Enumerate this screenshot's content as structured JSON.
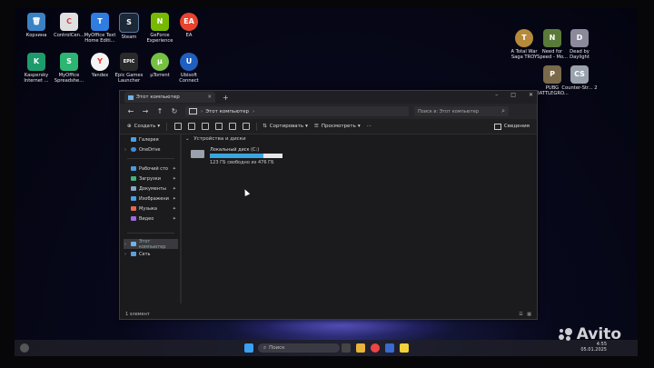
{
  "desktop_icons": [
    {
      "label": "Корзина",
      "icon": "recycle-bin-icon",
      "color": "#3b82c4"
    },
    {
      "label": "ControlCen...",
      "icon": "control-center-icon",
      "color": "#e0e0e0"
    },
    {
      "label": "MyOffice Text Home Editi...",
      "icon": "myoffice-text-icon",
      "color": "#2f7de1"
    },
    {
      "label": "Steam",
      "icon": "steam-icon",
      "color": "#1b2838"
    },
    {
      "label": "GeForce Experience",
      "icon": "geforce-icon",
      "color": "#76b900"
    },
    {
      "label": "EA",
      "icon": "ea-icon",
      "color": "#e8432e"
    },
    {
      "label": "Kaspersky Internet ...",
      "icon": "kaspersky-icon",
      "color": "#1d9b6c"
    },
    {
      "label": "MyOffice Spreadshe...",
      "icon": "myoffice-sheet-icon",
      "color": "#2bb673"
    },
    {
      "label": "Yandex",
      "icon": "yandex-icon",
      "color": "#f4f4f4"
    },
    {
      "label": "Epic Games Launcher",
      "icon": "epic-games-icon",
      "color": "#2a2a2a"
    },
    {
      "label": "µTorrent",
      "icon": "utorrent-icon",
      "color": "#76c043"
    },
    {
      "label": "Ubisoft Connect",
      "icon": "ubisoft-icon",
      "color": "#1f5fbf"
    },
    {
      "label": "A Total War Saga TROY",
      "icon": "troy-icon",
      "color": "#b58a3a"
    },
    {
      "label": "Need for Speed - Mo...",
      "icon": "nfs-icon",
      "color": "#5a7a3a"
    },
    {
      "label": "Dead by Daylight",
      "icon": "dbd-icon",
      "color": "#8a8a9a"
    },
    {
      "label": "PUBG BATTLEGRO...",
      "icon": "pubg-icon",
      "color": "#7a6a4a"
    },
    {
      "label": "Counter-Str... 2",
      "icon": "cs2-icon",
      "color": "#9aa3ad"
    }
  ],
  "explorer": {
    "tab_title": "Этот компьютер",
    "tab_close": "✕",
    "new_tab": "+",
    "window_controls": [
      "–",
      "□",
      "✕"
    ],
    "nav": {
      "back": "←",
      "forward": "→",
      "up": "↑",
      "refresh": "↻"
    },
    "address": {
      "path": "Этот компьютер",
      "chevron": "›"
    },
    "search_placeholder": "Поиск в: Этот компьютер",
    "toolbar": {
      "create": "Создать",
      "sort": "Сортировать",
      "view": "Просмотреть",
      "more": "···",
      "details": "Сведения"
    },
    "sidebar": [
      {
        "label": "Галерея",
        "icon": "gallery-icon",
        "color": "#4aa0e6"
      },
      {
        "label": "OneDrive",
        "icon": "onedrive-icon",
        "color": "#3d8be0",
        "expand": "›"
      },
      {
        "label": "Рабочий сто",
        "icon": "desktop-folder-icon",
        "color": "#4b9be0",
        "pin": "📌"
      },
      {
        "label": "Загрузки",
        "icon": "downloads-icon",
        "color": "#3fb47b",
        "pin": "📌"
      },
      {
        "label": "Документы",
        "icon": "documents-icon",
        "color": "#8aa6c8",
        "pin": "📌"
      },
      {
        "label": "Изображени",
        "icon": "pictures-icon",
        "color": "#4aa0e6",
        "pin": "📌"
      },
      {
        "label": "Музыка",
        "icon": "music-icon",
        "color": "#e46a4b",
        "pin": "📌"
      },
      {
        "label": "Видео",
        "icon": "video-icon",
        "color": "#9a6ae0",
        "pin": "📌"
      },
      {
        "label": "Этот компьютер",
        "icon": "this-pc-icon",
        "color": "#6fb3e8",
        "expand": "›"
      },
      {
        "label": "Сеть",
        "icon": "network-icon",
        "color": "#5aa0e0",
        "expand": "›"
      }
    ],
    "group_header": "Устройства и диски",
    "drive": {
      "name": "Локальный диск (C:)",
      "free": "123 ГБ свободно из 476 ГБ",
      "used_fraction": 0.74
    },
    "status": "1 элемент"
  },
  "taskbar": {
    "search_placeholder": "Поиск",
    "time": "4:55",
    "date": "05.01.2025"
  },
  "watermark": "Avito"
}
